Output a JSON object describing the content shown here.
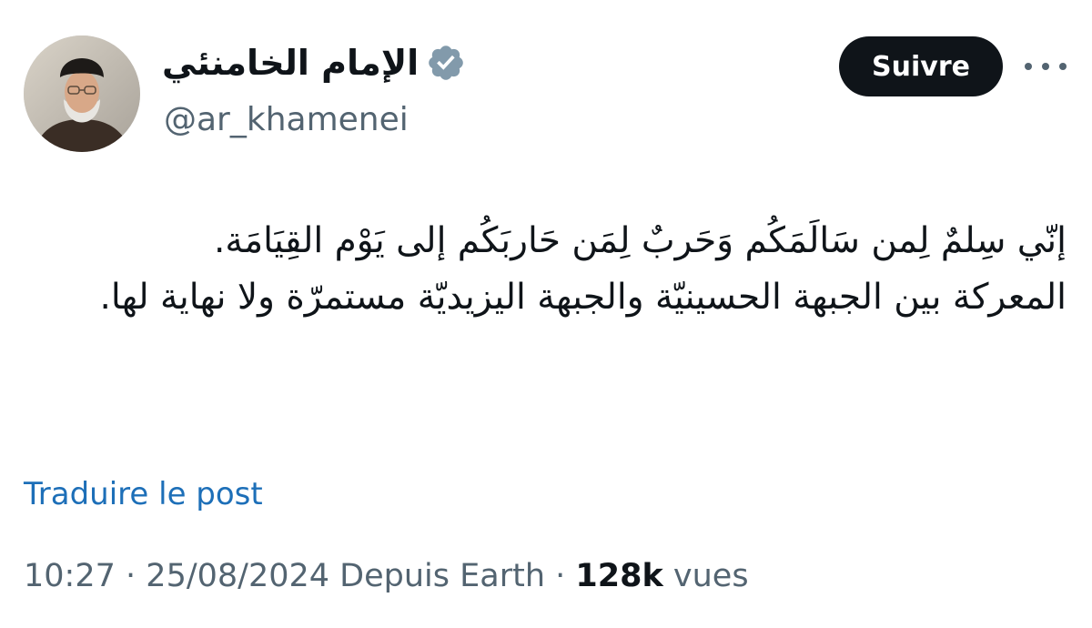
{
  "author": {
    "display_name": "الإمام الخامنئي",
    "handle": "@ar_khamenei",
    "verified_icon": "verified-badge-icon",
    "avatar_icon": "profile-avatar"
  },
  "actions": {
    "follow_label": "Suivre",
    "more_icon": "more-options-icon"
  },
  "post": {
    "lines": [
      "إنّي سِلمٌ لِمن سَالَمَكُم وَحَربٌ لِمَن حَاربَكُم إلى يَوْم القِيَامَة.",
      "المعركة بين الجبهة الحسينيّة والجبهة اليزيديّة مستمرّة ولا نهاية لها."
    ]
  },
  "translate_label": "Traduire le post",
  "meta": {
    "time": "10:27",
    "separator": "·",
    "date": "25/08/2024",
    "source": "Depuis Earth",
    "views_count": "128k",
    "views_label": "vues"
  },
  "colors": {
    "text": "#0f1419",
    "secondary": "#536471",
    "link": "#1d6fb8",
    "button": "#0f1419",
    "verified_badge": "#829aab"
  }
}
